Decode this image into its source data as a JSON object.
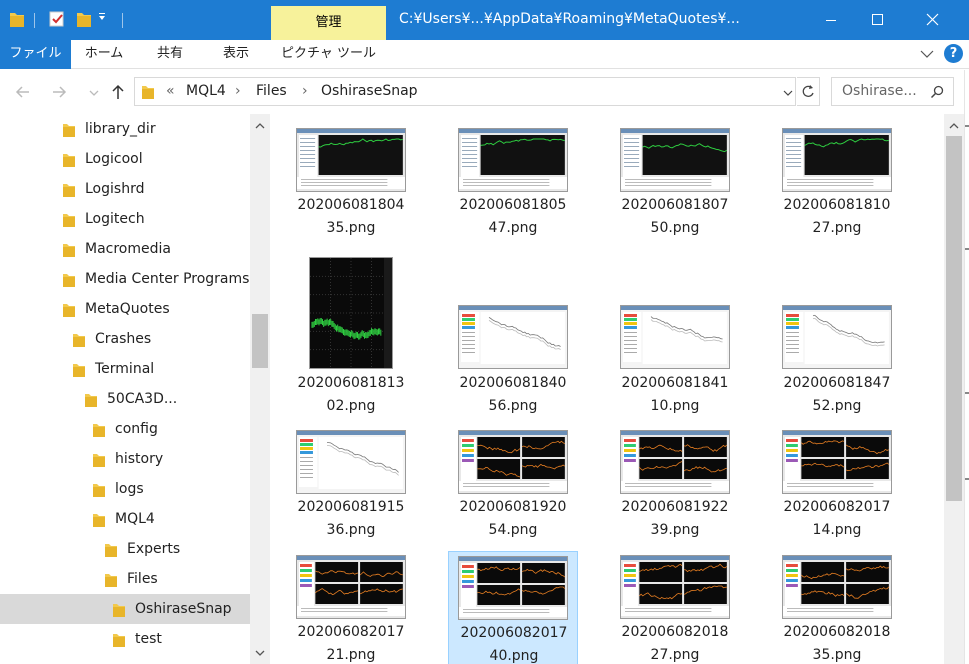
{
  "window": {
    "title": "C:¥Users¥...¥AppData¥Roaming¥MetaQuotes¥...",
    "contextual_tab": "管理",
    "accent": "#1e7cd2",
    "contextual_color": "#f7f29b"
  },
  "ribbon": {
    "tabs": [
      "ファイル",
      "ホーム",
      "共有",
      "表示",
      "ピクチャ ツール"
    ]
  },
  "address": {
    "overflow": "«",
    "crumbs": [
      "MQL4",
      "Files",
      "OshiraseSnap"
    ],
    "search_placeholder": "Oshirase..."
  },
  "tree": [
    {
      "label": "library_dir",
      "level": 0
    },
    {
      "label": "Logicool",
      "level": 0
    },
    {
      "label": "Logishrd",
      "level": 0
    },
    {
      "label": "Logitech",
      "level": 0
    },
    {
      "label": "Macromedia",
      "level": 0
    },
    {
      "label": "Media Center Programs",
      "level": 0
    },
    {
      "label": "MetaQuotes",
      "level": 0
    },
    {
      "label": "Crashes",
      "level": 1
    },
    {
      "label": "Terminal",
      "level": 1
    },
    {
      "label": "50CA3D...",
      "level": 2
    },
    {
      "label": "config",
      "level": 3
    },
    {
      "label": "history",
      "level": 3
    },
    {
      "label": "logs",
      "level": 3
    },
    {
      "label": "MQL4",
      "level": 3
    },
    {
      "label": "Experts",
      "level": 4
    },
    {
      "label": "Files",
      "level": 4
    },
    {
      "label": "OshiraseSnap",
      "level": 5,
      "selected": true
    },
    {
      "label": "test",
      "level": 5
    }
  ],
  "files": [
    {
      "line1": "202006081804",
      "line2": "35.png",
      "kind": "dark1"
    },
    {
      "line1": "202006081805",
      "line2": "47.png",
      "kind": "dark1"
    },
    {
      "line1": "202006081807",
      "line2": "50.png",
      "kind": "dark1"
    },
    {
      "line1": "202006081810",
      "line2": "27.png",
      "kind": "dark1"
    },
    {
      "line1": "202006081813",
      "line2": "02.png",
      "kind": "portrait"
    },
    {
      "line1": "202006081840",
      "line2": "56.png",
      "kind": "light"
    },
    {
      "line1": "202006081841",
      "line2": "10.png",
      "kind": "light"
    },
    {
      "line1": "202006081847",
      "line2": "52.png",
      "kind": "light"
    },
    {
      "line1": "202006081915",
      "line2": "36.png",
      "kind": "light"
    },
    {
      "line1": "202006081920",
      "line2": "54.png",
      "kind": "quad"
    },
    {
      "line1": "202006081922",
      "line2": "39.png",
      "kind": "quad"
    },
    {
      "line1": "202006082017",
      "line2": "14.png",
      "kind": "quad"
    },
    {
      "line1": "202006082017",
      "line2": "21.png",
      "kind": "quad"
    },
    {
      "line1": "202006082017",
      "line2": "40.png",
      "kind": "quad",
      "selected": true
    },
    {
      "line1": "202006082018",
      "line2": "27.png",
      "kind": "quad"
    },
    {
      "line1": "202006082018",
      "line2": "35.png",
      "kind": "quad"
    }
  ]
}
